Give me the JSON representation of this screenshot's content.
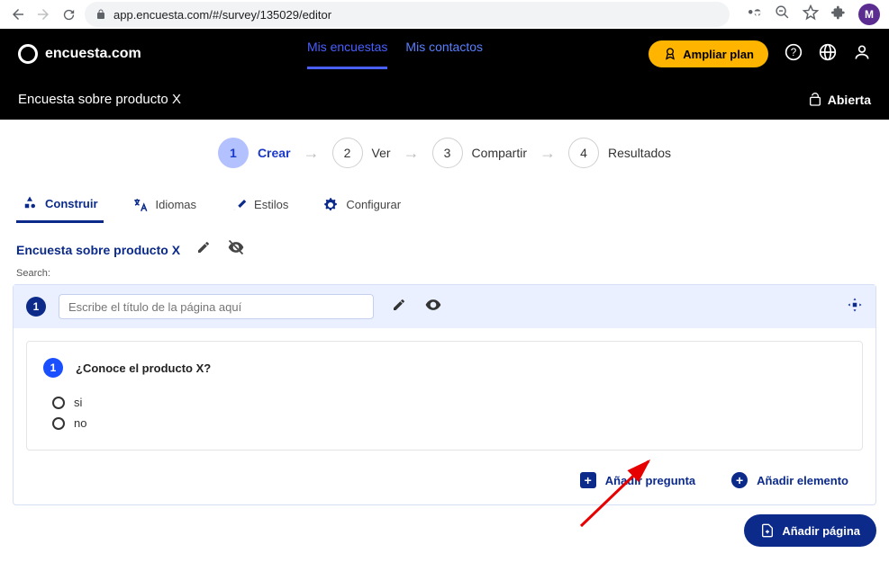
{
  "browser": {
    "url": "app.encuesta.com/#/survey/135029/editor",
    "avatar_letter": "M"
  },
  "header": {
    "brand": "encuesta.com",
    "nav": {
      "mis_encuestas": "Mis encuestas",
      "mis_contactos": "Mis contactos"
    },
    "ampliar": "Ampliar plan"
  },
  "subheader": {
    "title": "Encuesta sobre producto X",
    "status": "Abierta"
  },
  "steps": [
    {
      "num": "1",
      "label": "Crear"
    },
    {
      "num": "2",
      "label": "Ver"
    },
    {
      "num": "3",
      "label": "Compartir"
    },
    {
      "num": "4",
      "label": "Resultados"
    }
  ],
  "tabs": {
    "construir": "Construir",
    "idiomas": "Idiomas",
    "estilos": "Estilos",
    "configurar": "Configurar"
  },
  "editor": {
    "title": "Encuesta sobre producto X",
    "search_label": "Search:",
    "page_num": "1",
    "page_title_placeholder": "Escribe el título de la página aquí",
    "question": {
      "num": "1",
      "text": "¿Conoce el producto X?",
      "options": [
        "si",
        "no"
      ]
    },
    "add_question": "Añadir pregunta",
    "add_element": "Añadir elemento",
    "add_page": "Añadir página"
  }
}
